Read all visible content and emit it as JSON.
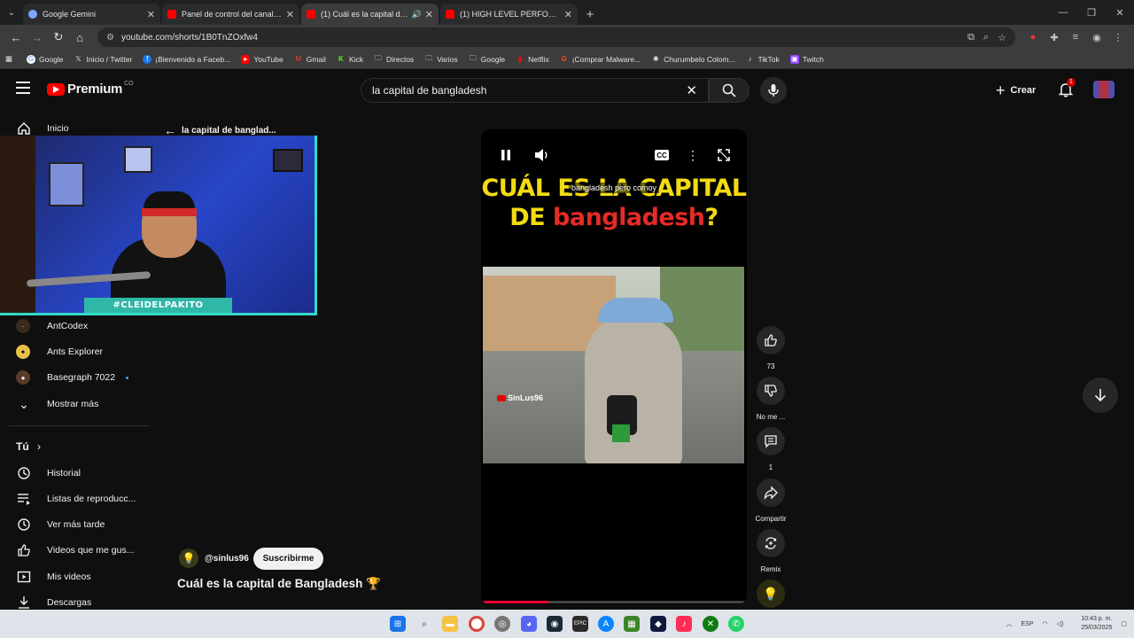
{
  "browser": {
    "tabs": [
      {
        "title": "Google Gemini",
        "color": "#7aa7ff",
        "active": false
      },
      {
        "title": "Panel de control del canal - YouTube",
        "color": "#ff0000",
        "active": false
      },
      {
        "title": "(1) Cuál es la capital de Bangladesh",
        "color": "#ff0000",
        "active": true
      },
      {
        "title": "(1) HIGH LEVEL PERFORMANCE",
        "color": "#ff0000",
        "active": false
      }
    ],
    "url": "youtube.com/shorts/1B0TnZOxfw4",
    "bookmarks": [
      {
        "label": "Google",
        "icon": "google-icon"
      },
      {
        "label": "Inicio / Twitter",
        "icon": "x-icon"
      },
      {
        "label": "¡Bienvenido a Faceb...",
        "icon": "facebook-icon"
      },
      {
        "label": "YouTube",
        "icon": "youtube-icon"
      },
      {
        "label": "Gmail",
        "icon": "gmail-icon"
      },
      {
        "label": "Kick",
        "icon": "kick-icon"
      },
      {
        "label": "Directos",
        "icon": "folder-icon"
      },
      {
        "label": "Varios",
        "icon": "folder-icon"
      },
      {
        "label": "Google",
        "icon": "folder-icon"
      },
      {
        "label": "Netflix",
        "icon": "netflix-icon"
      },
      {
        "label": "¡Comprar  Malware...",
        "icon": "site-icon"
      },
      {
        "label": "Churumbelo Colom...",
        "icon": "site-icon"
      },
      {
        "label": "TikTok",
        "icon": "tiktok-icon"
      },
      {
        "label": "Twitch",
        "icon": "twitch-icon"
      }
    ]
  },
  "header": {
    "logo_text": "Premium",
    "logo_country": "CO",
    "search_query": "la capital de bangladesh",
    "create_label": "Crear",
    "notification_count": "1"
  },
  "sidebar": {
    "home_label": "Inicio",
    "back_label": "la capital de banglad...",
    "webcam_tag": "#CLEIDELPAKITO",
    "channels": [
      {
        "label": "AntCodex"
      },
      {
        "label": "Ants Explorer"
      },
      {
        "label": "Basegraph 7022"
      }
    ],
    "show_more": "Mostrar más",
    "you_heading": "Tú",
    "you_items": [
      {
        "label": "Historial",
        "icon": "history-icon"
      },
      {
        "label": "Listas de reproducc...",
        "icon": "playlist-icon"
      },
      {
        "label": "Ver más tarde",
        "icon": "clock-icon"
      },
      {
        "label": "Videos que me gus...",
        "icon": "like-icon"
      },
      {
        "label": "Mis videos",
        "icon": "my-videos-icon"
      },
      {
        "label": "Descargas",
        "icon": "download-icon"
      }
    ]
  },
  "short": {
    "overlay_title_line1": "CUÁL ES LA CAPITAL",
    "overlay_title_de": "DE ",
    "overlay_title_red": "bangladesh",
    "overlay_title_q": "?",
    "caption": "bangladesh pero comoy",
    "watermark": "SinLus96",
    "progress": 0.25,
    "channel": "@sinlus96",
    "subscribe_label": "Suscribirme",
    "title": "Cuál es la capital de Bangladesh 🏆"
  },
  "actions": {
    "likes": "73",
    "dislike_label": "No me ...",
    "comments": "1",
    "share_label": "Compartir",
    "remix_label": "Remix"
  },
  "taskbar": {
    "lang": "ESP",
    "time": "10:43 p. m.",
    "date": "25/03/2025"
  }
}
